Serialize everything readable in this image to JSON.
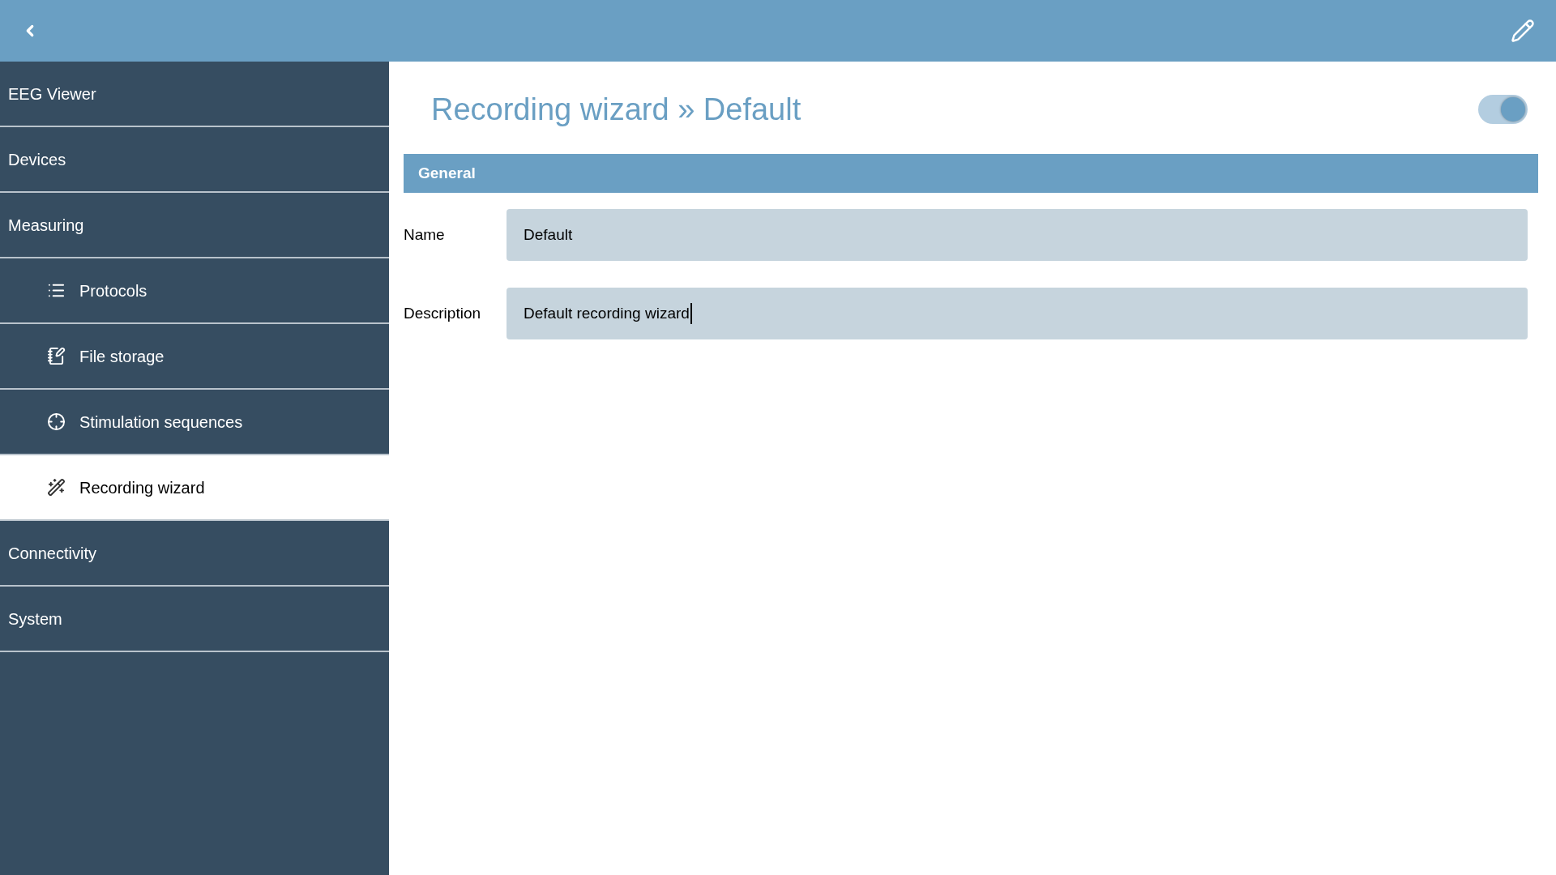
{
  "sidebar": {
    "items": [
      {
        "label": "EEG Viewer",
        "selected": false
      },
      {
        "label": "Devices",
        "selected": false
      },
      {
        "label": "Measuring",
        "selected": false,
        "children": [
          {
            "label": "Protocols",
            "selected": false
          },
          {
            "label": "File storage",
            "selected": false
          },
          {
            "label": "Stimulation sequences",
            "selected": false
          },
          {
            "label": "Recording wizard",
            "selected": true
          }
        ]
      },
      {
        "label": "Connectivity",
        "selected": false
      },
      {
        "label": "System",
        "selected": false
      }
    ]
  },
  "page": {
    "title": "Recording wizard » Default",
    "toggle": {
      "on": true
    }
  },
  "section": {
    "title": "General",
    "fields": [
      {
        "label": "Name",
        "value": "Default",
        "focused": false
      },
      {
        "label": "Description",
        "value": "Default recording wizard",
        "focused": true
      }
    ]
  }
}
